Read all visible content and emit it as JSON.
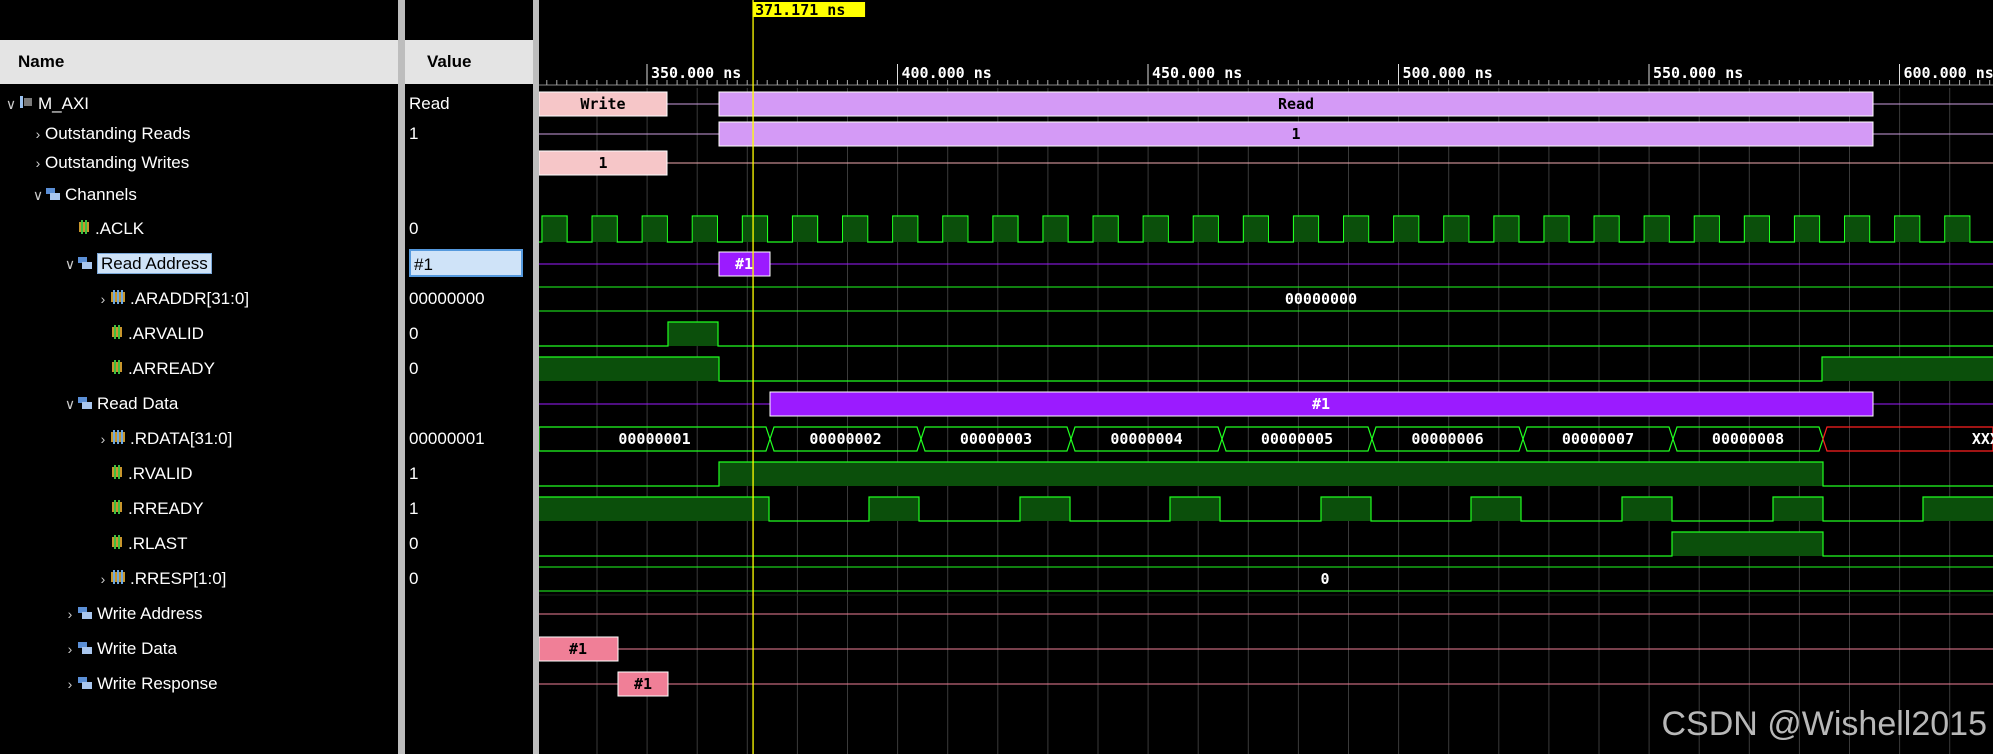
{
  "columns": {
    "name": "Name",
    "value": "Value"
  },
  "cursor": {
    "label": "371.171 ns"
  },
  "timeline": {
    "ticks": [
      {
        "label": "350.000 ns"
      },
      {
        "label": "400.000 ns"
      },
      {
        "label": "450.000 ns"
      },
      {
        "label": "500.000 ns"
      },
      {
        "label": "550.000 ns"
      },
      {
        "label": "600.000 ns"
      }
    ]
  },
  "signals": [
    {
      "name": "M_AXI",
      "value": "Read",
      "arrow": "expanded",
      "icon": "axi-interface-icon"
    },
    {
      "name": "Outstanding Reads",
      "value": "1",
      "arrow": "collapsed",
      "icon": ""
    },
    {
      "name": "Outstanding Writes",
      "value": "",
      "arrow": "collapsed",
      "icon": ""
    },
    {
      "name": "Channels",
      "value": "",
      "arrow": "expanded",
      "icon": "channel-group-icon"
    },
    {
      "name": ".ACLK",
      "value": "0",
      "arrow": "",
      "icon": "signal-icon"
    },
    {
      "name": "Read Address",
      "value": "#1",
      "arrow": "expanded",
      "icon": "channel-group-icon",
      "selected": true
    },
    {
      "name": ".ARADDR[31:0]",
      "value": "00000000",
      "arrow": "collapsed",
      "icon": "bus-icon"
    },
    {
      "name": ".ARVALID",
      "value": "0",
      "arrow": "",
      "icon": "signal-icon"
    },
    {
      "name": ".ARREADY",
      "value": "0",
      "arrow": "",
      "icon": "signal-icon"
    },
    {
      "name": "Read Data",
      "value": "",
      "arrow": "expanded",
      "icon": "channel-group-icon"
    },
    {
      "name": ".RDATA[31:0]",
      "value": "00000001",
      "arrow": "collapsed",
      "icon": "bus-icon"
    },
    {
      "name": ".RVALID",
      "value": "1",
      "arrow": "",
      "icon": "signal-icon"
    },
    {
      "name": ".RREADY",
      "value": "1",
      "arrow": "",
      "icon": "signal-icon"
    },
    {
      "name": ".RLAST",
      "value": "0",
      "arrow": "",
      "icon": "signal-icon"
    },
    {
      "name": ".RRESP[1:0]",
      "value": "0",
      "arrow": "collapsed",
      "icon": "bus-icon"
    },
    {
      "name": "Write Address",
      "value": "",
      "arrow": "collapsed",
      "icon": "channel-group-icon"
    },
    {
      "name": "Write Data",
      "value": "",
      "arrow": "collapsed",
      "icon": "channel-group-icon"
    },
    {
      "name": "Write Response",
      "value": "",
      "arrow": "collapsed",
      "icon": "channel-group-icon"
    }
  ],
  "waveform_labels": {
    "m_axi": [
      "Write",
      "Read"
    ],
    "outstanding_reads": "1",
    "outstanding_writes": "1",
    "read_address": "#1",
    "araddr": "00000000",
    "read_data": "#1",
    "rdata": [
      "00000001",
      "00000002",
      "00000003",
      "00000004",
      "00000005",
      "00000006",
      "00000007",
      "00000008",
      "XXXXXXXX"
    ],
    "rresp": "0",
    "write_data": "#1",
    "write_response": "#1"
  },
  "colors": {
    "transaction_read": "#d49af6",
    "transaction_write": "#f6c6c8",
    "channel_active": "#9b1bff",
    "write_channel": "#f07f97",
    "logic_green": "#20ff20",
    "logic_fill": "#0b4f0b",
    "cursor": "#ffff00",
    "undefined": "#ff2020"
  },
  "watermark": "CSDN @Wishell2015"
}
